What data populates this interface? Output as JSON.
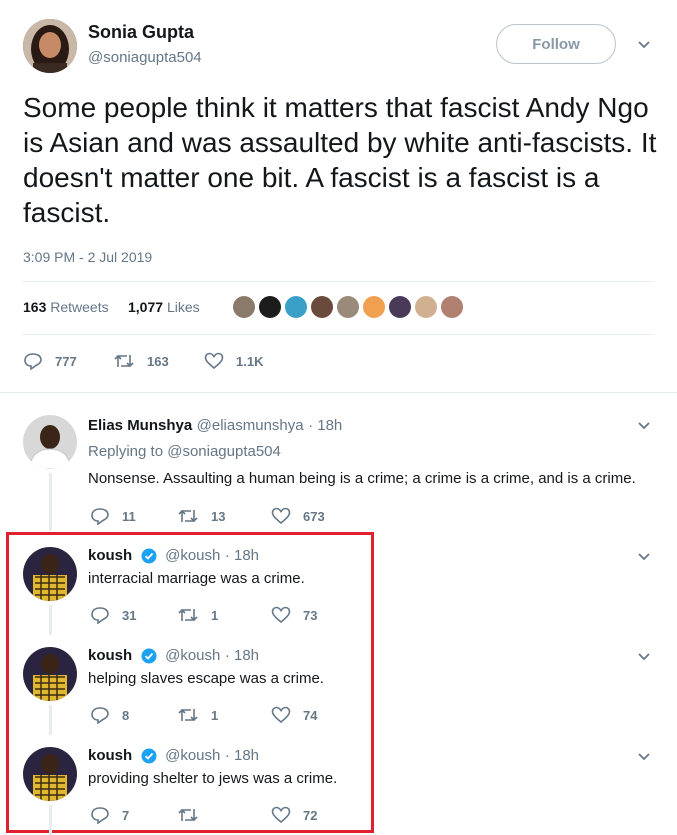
{
  "tweet": {
    "author_name": "Sonia Gupta",
    "author_handle": "@soniagupta504",
    "follow_label": "Follow",
    "text": "Some people think it matters that fascist Andy Ngo is Asian and was assaulted by white anti-fascists. It doesn't matter one bit. A fascist is a fascist is a fascist.",
    "timestamp": "3:09 PM - 2 Jul 2019",
    "retweets_count": "163",
    "retweets_label": "Retweets",
    "likes_count": "1,077",
    "likes_label": "Likes",
    "liker_avatar_colors": [
      "#8a7a6a",
      "#1c1c1c",
      "#3aa0c8",
      "#6a4a3a",
      "#9a8a7a",
      "#f0a050",
      "#4a3a5a",
      "#d0b090",
      "#b08070"
    ],
    "actions": {
      "replies": "777",
      "retweets": "163",
      "likes": "1.1K"
    }
  },
  "replies": [
    {
      "name": "Elias Munshya",
      "handle": "@eliasmunshya",
      "time": "· 18h",
      "replying_prefix": "Replying to",
      "replying_to": "@soniagupta504",
      "text": "Nonsense. Assaulting a human being is a crime; a crime is a crime, and is a crime.",
      "replies": "11",
      "retweets": "13",
      "likes": "673"
    },
    {
      "name": "koush",
      "handle": "@koush",
      "time": "· 18h",
      "text": "interracial marriage was a crime.",
      "replies": "31",
      "retweets": "1",
      "likes": "73"
    },
    {
      "name": "koush",
      "handle": "@koush",
      "time": "· 18h",
      "text": "helping slaves escape was a crime.",
      "replies": "8",
      "retweets": "1",
      "likes": "74"
    },
    {
      "name": "koush",
      "handle": "@koush",
      "time": "· 18h",
      "text": "providing shelter to jews was a crime.",
      "replies": "7",
      "retweets": "",
      "likes": "72"
    }
  ],
  "colors": {
    "highlight_border": "#e0202c",
    "muted": "#657786",
    "verified": "#1da1f2"
  }
}
